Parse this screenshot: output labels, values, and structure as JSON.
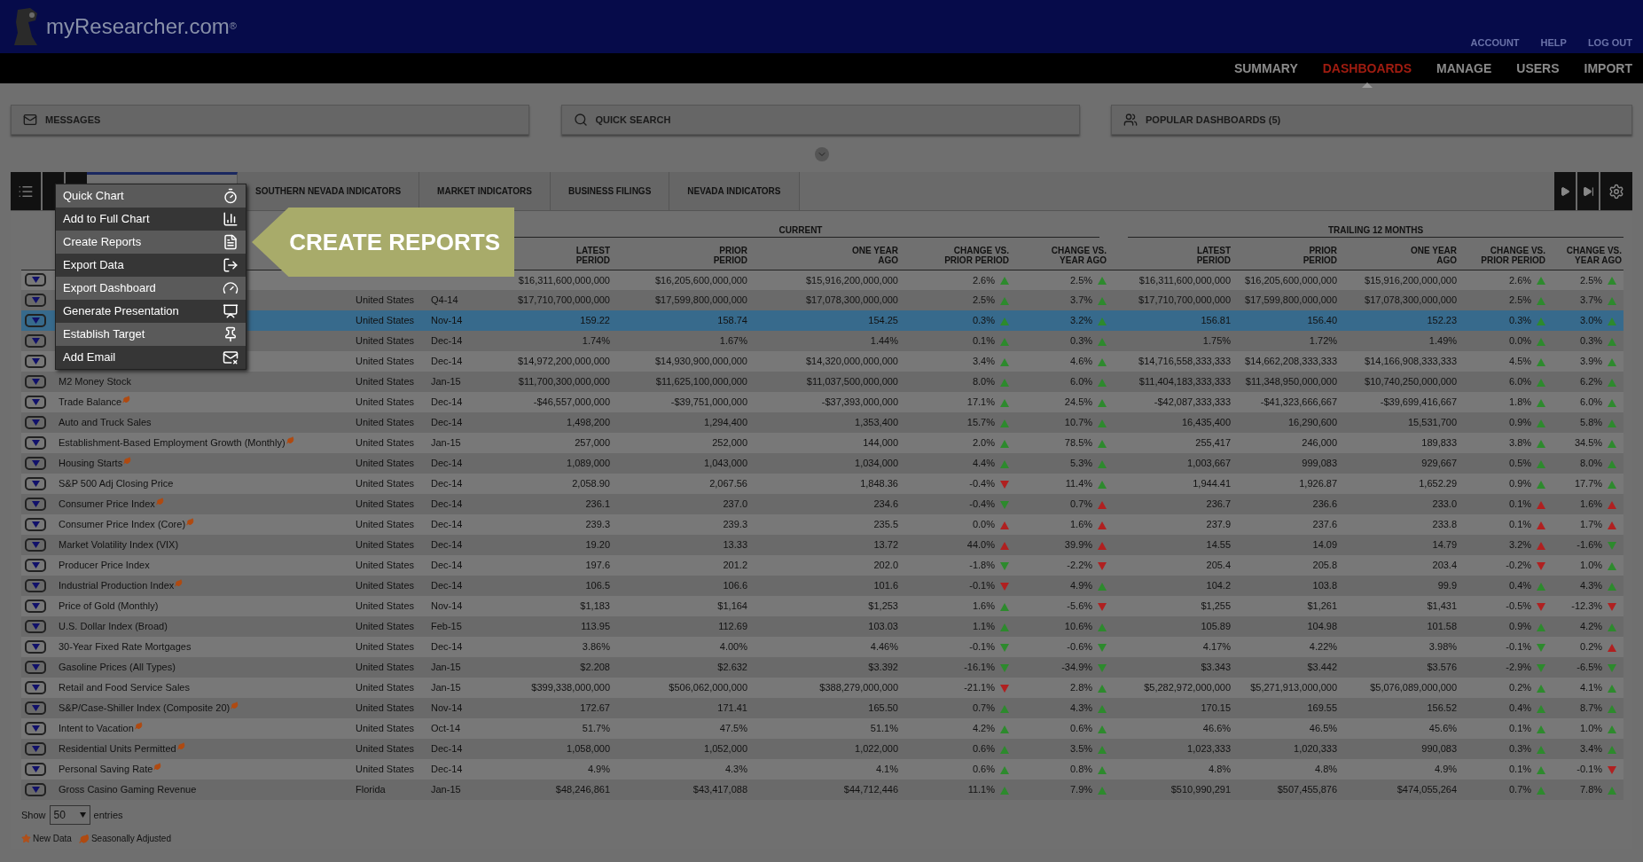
{
  "header": {
    "logo": "myResearcher.com",
    "logo_mark": "®",
    "links": [
      "ACCOUNT",
      "HELP",
      "LOG OUT"
    ]
  },
  "nav": [
    {
      "label": "SUMMARY",
      "selected": false
    },
    {
      "label": "DASHBOARDS",
      "selected": true
    },
    {
      "label": "MANAGE",
      "selected": false
    },
    {
      "label": "USERS",
      "selected": false
    },
    {
      "label": "IMPORT",
      "selected": false
    }
  ],
  "panels": [
    {
      "kind": "messages",
      "label": "MESSAGES"
    },
    {
      "kind": "search",
      "label": "QUICK SEARCH"
    },
    {
      "kind": "popular",
      "label": "POPULAR DASHBOARDS (5)"
    }
  ],
  "tabs": [
    {
      "selected": true
    },
    {
      "label": "SOUTHERN NEVADA INDICATORS",
      "selected": false
    },
    {
      "label": "MARKET INDICATORS",
      "selected": false
    },
    {
      "label": "BUSINESS FILINGS",
      "selected": false
    },
    {
      "label": "NEVADA INDICATORS",
      "selected": false
    }
  ],
  "menu": [
    {
      "label": "Quick Chart",
      "kind": "timer"
    },
    {
      "label": "Add to Full Chart",
      "kind": "chart"
    },
    {
      "label": "Create Reports",
      "kind": "report"
    },
    {
      "label": "Export Data",
      "kind": "export"
    },
    {
      "label": "Export Dashboard",
      "kind": "gauge"
    },
    {
      "label": "Generate Presentation",
      "kind": "presentation"
    },
    {
      "label": "Establish Target",
      "kind": "pin"
    },
    {
      "label": "Add Email",
      "kind": "mail"
    }
  ],
  "callout": "CREATE REPORTS",
  "groups": [
    "CURRENT",
    "TRAILING 12 MONTHS"
  ],
  "columns": [
    "LATEST PERIOD",
    "PRIOR PERIOD",
    "ONE YEAR AGO",
    "CHANGE VS. PRIOR PERIOD",
    "CHANGE VS. YEAR AGO",
    "LATEST PERIOD",
    "PRIOR PERIOD",
    "ONE YEAR AGO",
    "CHANGE VS. PRIOR PERIOD",
    "CHANGE VS. YEAR AGO"
  ],
  "rows": [
    {
      "selected": false,
      "seasonally_adjusted": false,
      "current": [
        "$16,311,600,000,000",
        "$16,205,600,000,000",
        "$15,916,200,000,000"
      ],
      "current_changes": [
        {
          "value": "2.6%",
          "rising": true,
          "good": true
        },
        {
          "value": "2.5%",
          "rising": true,
          "good": true
        }
      ],
      "trailing": [
        "$16,311,600,000,000",
        "$16,205,600,000,000",
        "$15,916,200,000,000"
      ],
      "trailing_changes": [
        {
          "value": "2.6%",
          "rising": true,
          "good": true
        },
        {
          "value": "2.5%",
          "rising": true,
          "good": true
        }
      ]
    },
    {
      "country": "United States",
      "period": "Q4-14",
      "selected": false,
      "seasonally_adjusted": false,
      "current": [
        "$17,710,700,000,000",
        "$17,599,800,000,000",
        "$17,078,300,000,000"
      ],
      "current_changes": [
        {
          "value": "2.5%",
          "rising": true,
          "good": true
        },
        {
          "value": "3.7%",
          "rising": true,
          "good": true
        }
      ],
      "trailing": [
        "$17,710,700,000,000",
        "$17,599,800,000,000",
        "$17,078,300,000,000"
      ],
      "trailing_changes": [
        {
          "value": "2.5%",
          "rising": true,
          "good": true
        },
        {
          "value": "3.7%",
          "rising": true,
          "good": true
        }
      ]
    },
    {
      "country": "United States",
      "period": "Nov-14",
      "selected": true,
      "seasonally_adjusted": false,
      "current": [
        "159.22",
        "158.74",
        "154.25"
      ],
      "current_changes": [
        {
          "value": "0.3%",
          "rising": true,
          "good": true
        },
        {
          "value": "3.2%",
          "rising": true,
          "good": true
        }
      ],
      "trailing": [
        "156.81",
        "156.40",
        "152.23"
      ],
      "trailing_changes": [
        {
          "value": "0.3%",
          "rising": true,
          "good": true
        },
        {
          "value": "3.0%",
          "rising": true,
          "good": true
        }
      ]
    },
    {
      "country": "United States",
      "period": "Dec-14",
      "selected": false,
      "seasonally_adjusted": false,
      "current": [
        "1.74%",
        "1.67%",
        "1.44%"
      ],
      "current_changes": [
        {
          "value": "0.1%",
          "rising": true,
          "good": true
        },
        {
          "value": "0.3%",
          "rising": true,
          "good": true
        }
      ],
      "trailing": [
        "1.75%",
        "1.72%",
        "1.49%"
      ],
      "trailing_changes": [
        {
          "value": "0.0%",
          "rising": true,
          "good": true
        },
        {
          "value": "0.3%",
          "rising": true,
          "good": true
        }
      ]
    },
    {
      "country": "United States",
      "period": "Dec-14",
      "selected": false,
      "seasonally_adjusted": false,
      "current": [
        "$14,972,200,000,000",
        "$14,930,900,000,000",
        "$14,320,000,000,000"
      ],
      "current_changes": [
        {
          "value": "3.4%",
          "rising": true,
          "good": true
        },
        {
          "value": "4.6%",
          "rising": true,
          "good": true
        }
      ],
      "trailing": [
        "$14,716,558,333,333",
        "$14,662,208,333,333",
        "$14,166,908,333,333"
      ],
      "trailing_changes": [
        {
          "value": "4.5%",
          "rising": true,
          "good": true
        },
        {
          "value": "3.9%",
          "rising": true,
          "good": true
        }
      ]
    },
    {
      "name": "M2 Money Stock",
      "country": "United States",
      "period": "Jan-15",
      "selected": false,
      "seasonally_adjusted": false,
      "current": [
        "$11,700,300,000,000",
        "$11,625,100,000,000",
        "$11,037,500,000,000"
      ],
      "current_changes": [
        {
          "value": "8.0%",
          "rising": true,
          "good": true
        },
        {
          "value": "6.0%",
          "rising": true,
          "good": true
        }
      ],
      "trailing": [
        "$11,404,183,333,333",
        "$11,348,950,000,000",
        "$10,740,250,000,000"
      ],
      "trailing_changes": [
        {
          "value": "6.0%",
          "rising": true,
          "good": true
        },
        {
          "value": "6.2%",
          "rising": true,
          "good": true
        }
      ]
    },
    {
      "name": "Trade Balance",
      "country": "United States",
      "period": "Dec-14",
      "selected": false,
      "seasonally_adjusted": true,
      "current": [
        "-$46,557,000,000",
        "-$39,751,000,000",
        "-$37,393,000,000"
      ],
      "current_changes": [
        {
          "value": "17.1%",
          "rising": true,
          "good": true
        },
        {
          "value": "24.5%",
          "rising": true,
          "good": true
        }
      ],
      "trailing": [
        "-$42,087,333,333",
        "-$41,323,666,667",
        "-$39,699,416,667"
      ],
      "trailing_changes": [
        {
          "value": "1.8%",
          "rising": true,
          "good": true
        },
        {
          "value": "6.0%",
          "rising": true,
          "good": true
        }
      ]
    },
    {
      "name": "Auto and Truck Sales",
      "country": "United States",
      "period": "Dec-14",
      "selected": false,
      "seasonally_adjusted": false,
      "current": [
        "1,498,200",
        "1,294,400",
        "1,353,400"
      ],
      "current_changes": [
        {
          "value": "15.7%",
          "rising": true,
          "good": true
        },
        {
          "value": "10.7%",
          "rising": true,
          "good": true
        }
      ],
      "trailing": [
        "16,435,400",
        "16,290,600",
        "15,531,700"
      ],
      "trailing_changes": [
        {
          "value": "0.9%",
          "rising": true,
          "good": true
        },
        {
          "value": "5.8%",
          "rising": true,
          "good": true
        }
      ]
    },
    {
      "name": "Establishment-Based Employment Growth (Monthly)",
      "country": "United States",
      "period": "Jan-15",
      "selected": false,
      "seasonally_adjusted": true,
      "current": [
        "257,000",
        "252,000",
        "144,000"
      ],
      "current_changes": [
        {
          "value": "2.0%",
          "rising": true,
          "good": true
        },
        {
          "value": "78.5%",
          "rising": true,
          "good": true
        }
      ],
      "trailing": [
        "255,417",
        "246,000",
        "189,833"
      ],
      "trailing_changes": [
        {
          "value": "3.8%",
          "rising": true,
          "good": true
        },
        {
          "value": "34.5%",
          "rising": true,
          "good": true
        }
      ]
    },
    {
      "name": "Housing Starts",
      "country": "United States",
      "period": "Dec-14",
      "selected": false,
      "seasonally_adjusted": true,
      "current": [
        "1,089,000",
        "1,043,000",
        "1,034,000"
      ],
      "current_changes": [
        {
          "value": "4.4%",
          "rising": true,
          "good": true
        },
        {
          "value": "5.3%",
          "rising": true,
          "good": true
        }
      ],
      "trailing": [
        "1,003,667",
        "999,083",
        "929,667"
      ],
      "trailing_changes": [
        {
          "value": "0.5%",
          "rising": true,
          "good": true
        },
        {
          "value": "8.0%",
          "rising": true,
          "good": true
        }
      ]
    },
    {
      "name": "S&P 500 Adj Closing Price",
      "country": "United States",
      "period": "Dec-14",
      "selected": false,
      "seasonally_adjusted": false,
      "current": [
        "2,058.90",
        "2,067.56",
        "1,848.36"
      ],
      "current_changes": [
        {
          "value": "-0.4%",
          "rising": false,
          "good": false
        },
        {
          "value": "11.4%",
          "rising": true,
          "good": true
        }
      ],
      "trailing": [
        "1,944.41",
        "1,926.87",
        "1,652.29"
      ],
      "trailing_changes": [
        {
          "value": "0.9%",
          "rising": true,
          "good": true
        },
        {
          "value": "17.7%",
          "rising": true,
          "good": true
        }
      ]
    },
    {
      "name": "Consumer Price Index",
      "country": "United States",
      "period": "Dec-14",
      "selected": false,
      "seasonally_adjusted": true,
      "current": [
        "236.1",
        "237.0",
        "234.6"
      ],
      "current_changes": [
        {
          "value": "-0.4%",
          "rising": false,
          "good": true
        },
        {
          "value": "0.7%",
          "rising": true,
          "good": false
        }
      ],
      "trailing": [
        "236.7",
        "236.6",
        "233.0"
      ],
      "trailing_changes": [
        {
          "value": "0.1%",
          "rising": true,
          "good": false
        },
        {
          "value": "1.6%",
          "rising": true,
          "good": false
        }
      ]
    },
    {
      "name": "Consumer Price Index (Core)",
      "country": "United States",
      "period": "Dec-14",
      "selected": false,
      "seasonally_adjusted": true,
      "current": [
        "239.3",
        "239.3",
        "235.5"
      ],
      "current_changes": [
        {
          "value": "0.0%",
          "rising": true,
          "good": false
        },
        {
          "value": "1.6%",
          "rising": true,
          "good": false
        }
      ],
      "trailing": [
        "237.9",
        "237.6",
        "233.8"
      ],
      "trailing_changes": [
        {
          "value": "0.1%",
          "rising": true,
          "good": false
        },
        {
          "value": "1.7%",
          "rising": true,
          "good": false
        }
      ]
    },
    {
      "name": "Market Volatility Index (VIX)",
      "country": "United States",
      "period": "Dec-14",
      "selected": false,
      "seasonally_adjusted": false,
      "current": [
        "19.20",
        "13.33",
        "13.72"
      ],
      "current_changes": [
        {
          "value": "44.0%",
          "rising": true,
          "good": false
        },
        {
          "value": "39.9%",
          "rising": true,
          "good": false
        }
      ],
      "trailing": [
        "14.55",
        "14.09",
        "14.79"
      ],
      "trailing_changes": [
        {
          "value": "3.2%",
          "rising": true,
          "good": false
        },
        {
          "value": "-1.6%",
          "rising": false,
          "good": true
        }
      ]
    },
    {
      "name": "Producer Price Index",
      "country": "United States",
      "period": "Dec-14",
      "selected": false,
      "seasonally_adjusted": false,
      "current": [
        "197.6",
        "201.2",
        "202.0"
      ],
      "current_changes": [
        {
          "value": "-1.8%",
          "rising": false,
          "good": true
        },
        {
          "value": "-2.2%",
          "rising": false,
          "good": false
        }
      ],
      "trailing": [
        "205.4",
        "205.8",
        "203.4"
      ],
      "trailing_changes": [
        {
          "value": "-0.2%",
          "rising": false,
          "good": false
        },
        {
          "value": "1.0%",
          "rising": true,
          "good": true
        }
      ]
    },
    {
      "name": "Industrial Production Index",
      "country": "United States",
      "period": "Dec-14",
      "selected": false,
      "seasonally_adjusted": true,
      "current": [
        "106.5",
        "106.6",
        "101.6"
      ],
      "current_changes": [
        {
          "value": "-0.1%",
          "rising": false,
          "good": false
        },
        {
          "value": "4.9%",
          "rising": true,
          "good": true
        }
      ],
      "trailing": [
        "104.2",
        "103.8",
        "99.9"
      ],
      "trailing_changes": [
        {
          "value": "0.4%",
          "rising": true,
          "good": true
        },
        {
          "value": "4.3%",
          "rising": true,
          "good": true
        }
      ]
    },
    {
      "name": "Price of Gold (Monthly)",
      "country": "United States",
      "period": "Nov-14",
      "selected": false,
      "seasonally_adjusted": false,
      "current": [
        "$1,183",
        "$1,164",
        "$1,253"
      ],
      "current_changes": [
        {
          "value": "1.6%",
          "rising": true,
          "good": true
        },
        {
          "value": "-5.6%",
          "rising": false,
          "good": false
        }
      ],
      "trailing": [
        "$1,255",
        "$1,261",
        "$1,431"
      ],
      "trailing_changes": [
        {
          "value": "-0.5%",
          "rising": false,
          "good": false
        },
        {
          "value": "-12.3%",
          "rising": false,
          "good": false
        }
      ]
    },
    {
      "name": "U.S. Dollar Index (Broad)",
      "country": "United States",
      "period": "Feb-15",
      "selected": false,
      "seasonally_adjusted": false,
      "current": [
        "113.95",
        "112.69",
        "103.03"
      ],
      "current_changes": [
        {
          "value": "1.1%",
          "rising": true,
          "good": true
        },
        {
          "value": "10.6%",
          "rising": true,
          "good": true
        }
      ],
      "trailing": [
        "105.89",
        "104.98",
        "101.58"
      ],
      "trailing_changes": [
        {
          "value": "0.9%",
          "rising": true,
          "good": true
        },
        {
          "value": "4.2%",
          "rising": true,
          "good": true
        }
      ]
    },
    {
      "name": "30-Year Fixed Rate Mortgages",
      "country": "United States",
      "period": "Dec-14",
      "selected": false,
      "seasonally_adjusted": false,
      "current": [
        "3.86%",
        "4.00%",
        "4.46%"
      ],
      "current_changes": [
        {
          "value": "-0.1%",
          "rising": false,
          "good": true
        },
        {
          "value": "-0.6%",
          "rising": false,
          "good": true
        }
      ],
      "trailing": [
        "4.17%",
        "4.22%",
        "3.98%"
      ],
      "trailing_changes": [
        {
          "value": "-0.1%",
          "rising": false,
          "good": true
        },
        {
          "value": "0.2%",
          "rising": true,
          "good": false
        }
      ]
    },
    {
      "name": "Gasoline Prices (All Types)",
      "country": "United States",
      "period": "Jan-15",
      "selected": false,
      "seasonally_adjusted": false,
      "current": [
        "$2.208",
        "$2.632",
        "$3.392"
      ],
      "current_changes": [
        {
          "value": "-16.1%",
          "rising": false,
          "good": true
        },
        {
          "value": "-34.9%",
          "rising": false,
          "good": true
        }
      ],
      "trailing": [
        "$3.343",
        "$3.442",
        "$3.576"
      ],
      "trailing_changes": [
        {
          "value": "-2.9%",
          "rising": false,
          "good": true
        },
        {
          "value": "-6.5%",
          "rising": false,
          "good": true
        }
      ]
    },
    {
      "name": "Retail and Food Service Sales",
      "country": "United States",
      "period": "Jan-15",
      "selected": false,
      "seasonally_adjusted": false,
      "current": [
        "$399,338,000,000",
        "$506,062,000,000",
        "$388,279,000,000"
      ],
      "current_changes": [
        {
          "value": "-21.1%",
          "rising": false,
          "good": false
        },
        {
          "value": "2.8%",
          "rising": true,
          "good": true
        }
      ],
      "trailing": [
        "$5,282,972,000,000",
        "$5,271,913,000,000",
        "$5,076,089,000,000"
      ],
      "trailing_changes": [
        {
          "value": "0.2%",
          "rising": true,
          "good": true
        },
        {
          "value": "4.1%",
          "rising": true,
          "good": true
        }
      ]
    },
    {
      "name": "S&P/Case-Shiller Index (Composite 20)",
      "country": "United States",
      "period": "Nov-14",
      "selected": false,
      "seasonally_adjusted": true,
      "current": [
        "172.67",
        "171.41",
        "165.50"
      ],
      "current_changes": [
        {
          "value": "0.7%",
          "rising": true,
          "good": true
        },
        {
          "value": "4.3%",
          "rising": true,
          "good": true
        }
      ],
      "trailing": [
        "170.15",
        "169.55",
        "156.52"
      ],
      "trailing_changes": [
        {
          "value": "0.4%",
          "rising": true,
          "good": true
        },
        {
          "value": "8.7%",
          "rising": true,
          "good": true
        }
      ]
    },
    {
      "name": "Intent to Vacation",
      "country": "United States",
      "period": "Oct-14",
      "selected": false,
      "seasonally_adjusted": true,
      "current": [
        "51.7%",
        "47.5%",
        "51.1%"
      ],
      "current_changes": [
        {
          "value": "4.2%",
          "rising": true,
          "good": true
        },
        {
          "value": "0.6%",
          "rising": true,
          "good": true
        }
      ],
      "trailing": [
        "46.6%",
        "46.5%",
        "45.6%"
      ],
      "trailing_changes": [
        {
          "value": "0.1%",
          "rising": true,
          "good": true
        },
        {
          "value": "1.0%",
          "rising": true,
          "good": true
        }
      ]
    },
    {
      "name": "Residential Units Permitted",
      "country": "United States",
      "period": "Dec-14",
      "selected": false,
      "seasonally_adjusted": true,
      "current": [
        "1,058,000",
        "1,052,000",
        "1,022,000"
      ],
      "current_changes": [
        {
          "value": "0.6%",
          "rising": true,
          "good": true
        },
        {
          "value": "3.5%",
          "rising": true,
          "good": true
        }
      ],
      "trailing": [
        "1,023,333",
        "1,020,333",
        "990,083"
      ],
      "trailing_changes": [
        {
          "value": "0.3%",
          "rising": true,
          "good": true
        },
        {
          "value": "3.4%",
          "rising": true,
          "good": true
        }
      ]
    },
    {
      "name": "Personal Saving Rate",
      "country": "United States",
      "period": "Dec-14",
      "selected": false,
      "seasonally_adjusted": true,
      "current": [
        "4.9%",
        "4.3%",
        "4.1%"
      ],
      "current_changes": [
        {
          "value": "0.6%",
          "rising": true,
          "good": true
        },
        {
          "value": "0.8%",
          "rising": true,
          "good": true
        }
      ],
      "trailing": [
        "4.8%",
        "4.8%",
        "4.9%"
      ],
      "trailing_changes": [
        {
          "value": "0.1%",
          "rising": true,
          "good": true
        },
        {
          "value": "-0.1%",
          "rising": false,
          "good": false
        }
      ]
    },
    {
      "name": "Gross Casino Gaming Revenue",
      "country": "Florida",
      "period": "Jan-15",
      "selected": false,
      "seasonally_adjusted": false,
      "current": [
        "$48,246,861",
        "$43,417,088",
        "$44,712,446"
      ],
      "current_changes": [
        {
          "value": "11.1%",
          "rising": true,
          "good": true
        },
        {
          "value": "7.9%",
          "rising": true,
          "good": true
        }
      ],
      "trailing": [
        "$510,990,291",
        "$507,455,876",
        "$474,055,264"
      ],
      "trailing_changes": [
        {
          "value": "0.7%",
          "rising": true,
          "good": true
        },
        {
          "value": "7.8%",
          "rising": true,
          "good": true
        }
      ]
    }
  ],
  "footer": {
    "show_label": "Show",
    "entries_value": "50",
    "entries_label": "entries",
    "legend": [
      {
        "kind": "new",
        "label": "New Data"
      },
      {
        "kind": "seasonal",
        "label": "Seasonally Adjusted"
      }
    ]
  }
}
